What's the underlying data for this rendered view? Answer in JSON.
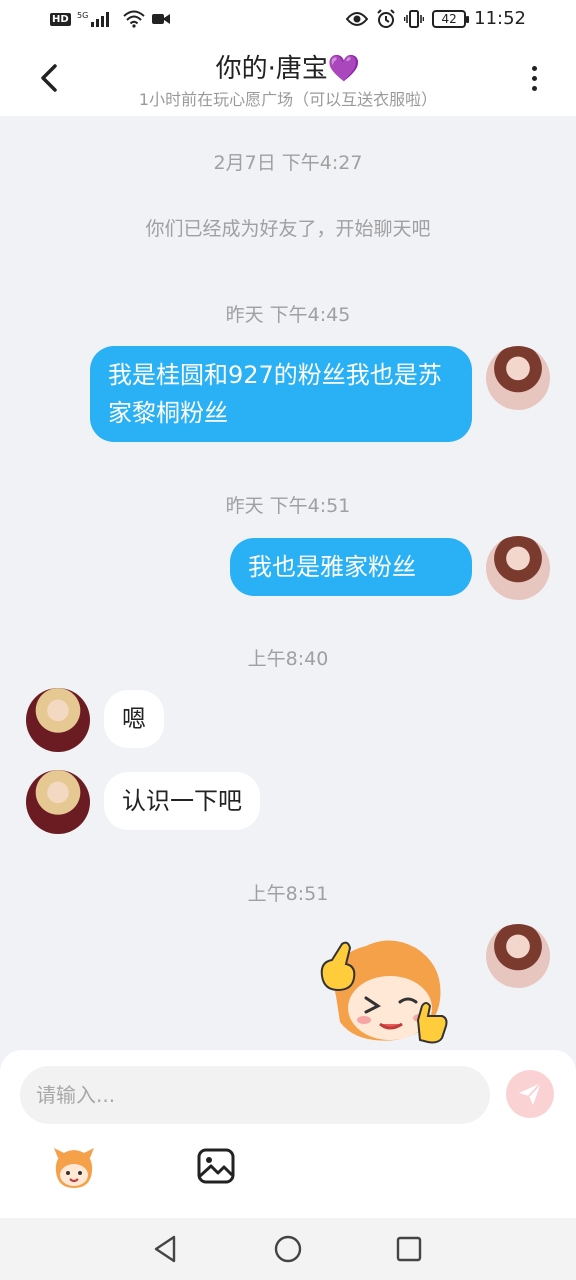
{
  "status_bar": {
    "time": "11:52",
    "battery": "42",
    "network": "5G"
  },
  "header": {
    "title": "你的·唐宝💜",
    "subtitle": "1小时前在玩心愿广场（可以互送衣服啦）"
  },
  "messages": [
    {
      "type": "timestamp",
      "text": "2月7日 下午4:27"
    },
    {
      "type": "system",
      "text": "你们已经成为好友了，开始聊天吧"
    },
    {
      "type": "timestamp",
      "text": "昨天 下午4:45"
    },
    {
      "type": "text",
      "sender": "me",
      "text": "我是桂圆和927的粉丝我也是苏家黎桐粉丝"
    },
    {
      "type": "timestamp",
      "text": "昨天 下午4:51"
    },
    {
      "type": "text",
      "sender": "me",
      "text": "我也是雅家粉丝"
    },
    {
      "type": "timestamp",
      "text": "上午8:40"
    },
    {
      "type": "text",
      "sender": "them",
      "text": "嗯"
    },
    {
      "type": "text",
      "sender": "them",
      "text": "认识一下吧"
    },
    {
      "type": "timestamp",
      "text": "上午8:51"
    },
    {
      "type": "sticker",
      "sender": "me",
      "icon": "wink-thumbs-up-sticker"
    }
  ],
  "input": {
    "placeholder": "请输入..."
  },
  "colors": {
    "my_bubble": "#2ab1f5",
    "their_bubble": "#ffffff",
    "background": "#f1f2f6",
    "send_button": "#fbd2d4"
  }
}
